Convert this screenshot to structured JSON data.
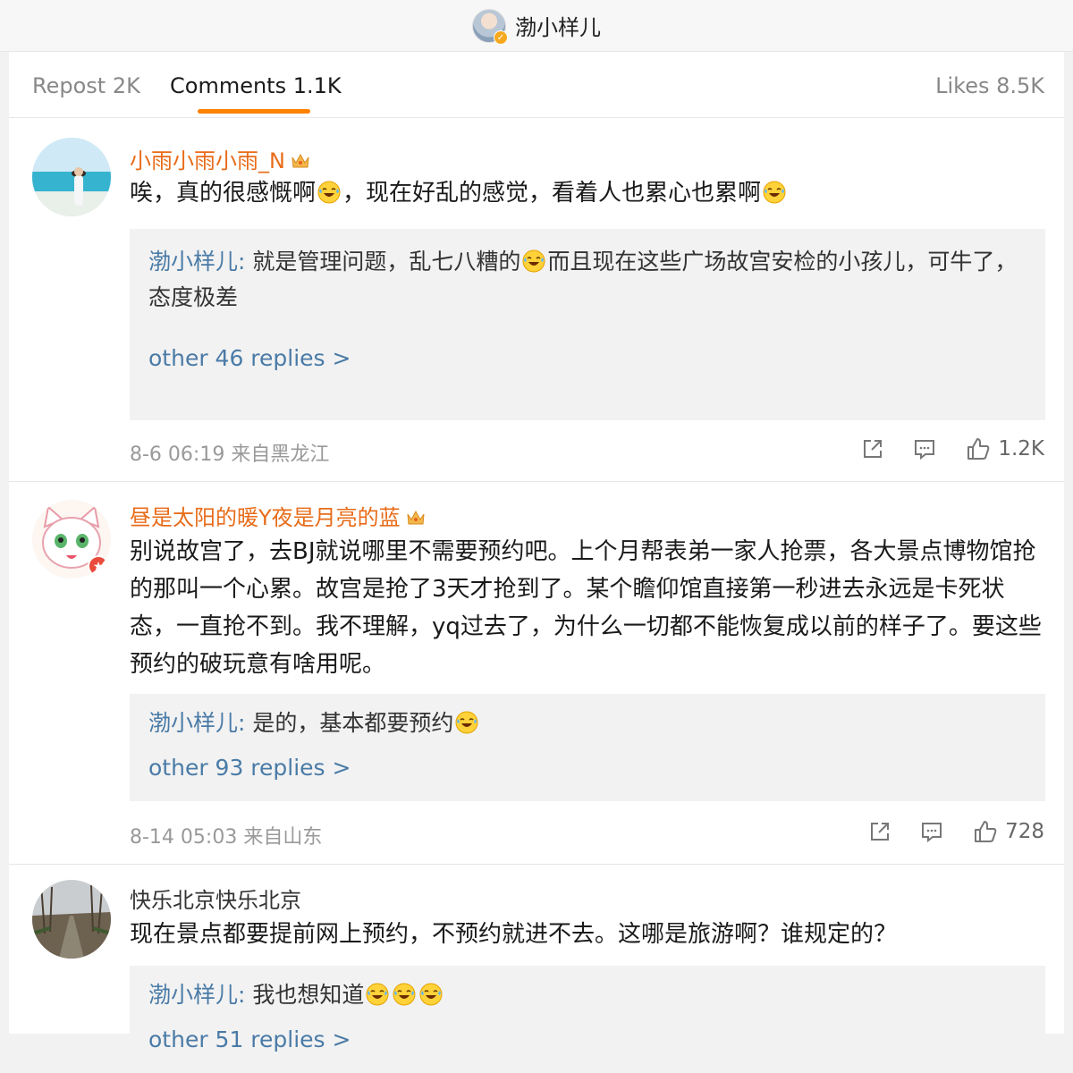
{
  "header": {
    "title": "渤小样儿"
  },
  "tabs": [
    {
      "label": "Repost 2K"
    },
    {
      "label": "Comments 1.1K"
    },
    {
      "label": "Likes 8.5K"
    }
  ],
  "colors": {
    "accent": "#ff8200",
    "vip_name": "#e86c1a",
    "reply_link": "#4a7ba7"
  },
  "comments": [
    {
      "username": "小雨小雨小雨_N",
      "text_parts": [
        "唉，真的很感慨啊",
        "，现在好乱的感觉，看着人也累心也累啊"
      ],
      "reply": {
        "author": "渤小样儿",
        "separator": ": ",
        "text_parts": [
          "就是管理问题，乱七八糟的",
          "而且现在这些广场故宫安检的小孩儿，可牛了，态度极差"
        ]
      },
      "more_replies": "other 46 replies >",
      "meta": "8-6 06:19 来自黑龙江",
      "likes": "1.2K"
    },
    {
      "username": "昼是太阳的暖Y夜是月亮的蓝",
      "text": "别说故宫了，去BJ就说哪里不需要预约吧。上个月帮表弟一家人抢票，各大景点博物馆抢的那叫一个心累。故宫是抢了3天才抢到了。某个瞻仰馆直接第一秒进去永远是卡死状态，一直抢不到。我不理解，yq过去了，为什么一切都不能恢复成以前的样子了。要这些预约的破玩意有啥用呢。",
      "reply": {
        "author": "渤小样儿",
        "separator": ": ",
        "text": "是的，基本都要预约"
      },
      "more_replies": "other 93 replies >",
      "meta": "8-14 05:03 来自山东",
      "likes": "728"
    },
    {
      "username": "快乐北京快乐北京",
      "text": "现在景点都要提前网上预约，不预约就进不去。这哪是旅游啊？谁规定的？",
      "reply": {
        "author": "渤小样儿",
        "separator": ": ",
        "text": "我也想知道"
      },
      "more_replies": "other 51 replies >"
    }
  ],
  "icons": [
    "share-icon",
    "comment-icon",
    "like-icon",
    "laugh-cry-emoji",
    "crown-icon",
    "verified-badge-icon"
  ]
}
